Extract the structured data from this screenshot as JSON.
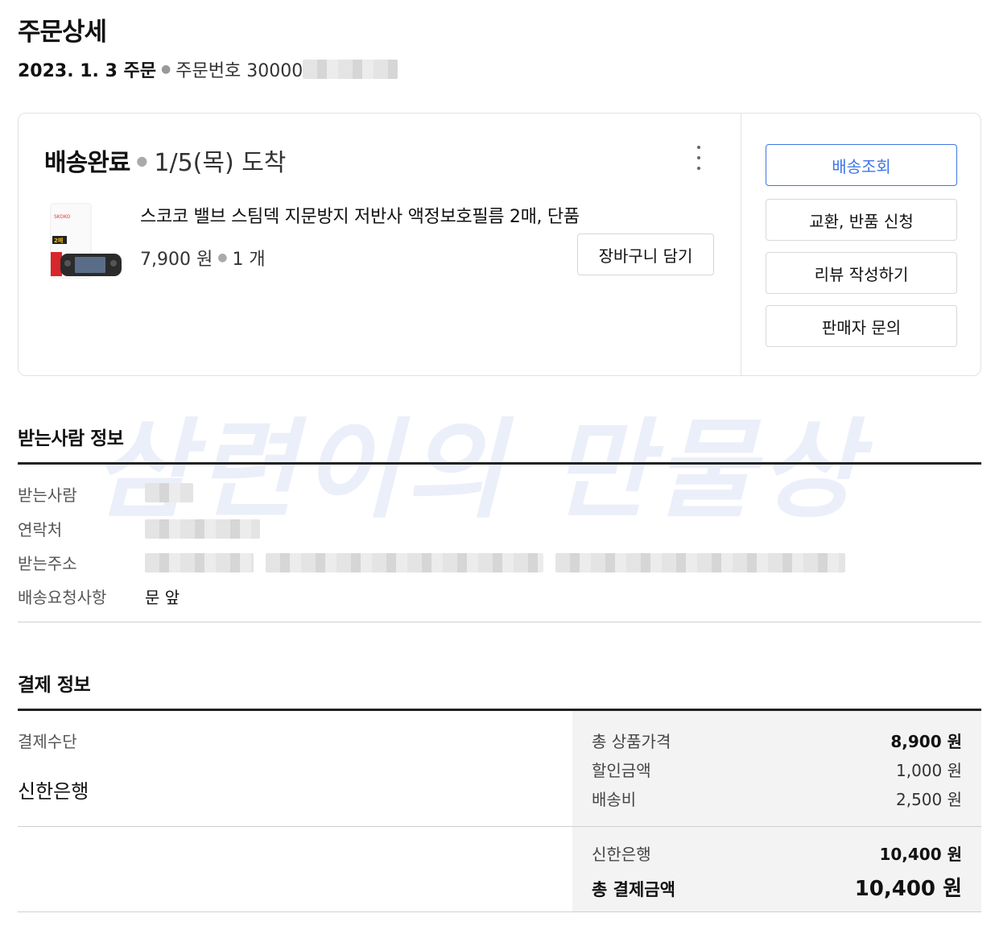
{
  "page": {
    "title": "주문상세"
  },
  "order": {
    "date_label": "2023. 1. 3 주문",
    "number_label": "주문번호 30000"
  },
  "shipment": {
    "status": "배송완료",
    "arrival": "1/5(목) 도착",
    "product": {
      "name": "스코코 밸브 스팀덱 지문방지 저반사 액정보호필름 2매, 단품",
      "price": "7,900 원",
      "quantity": "1 개",
      "thumb_brand": "SKOKO",
      "thumb_badge": "2매"
    },
    "cart_button": "장바구니 담기",
    "actions": [
      "배송조회",
      "교환, 반품 신청",
      "리뷰 작성하기",
      "판매자 문의"
    ]
  },
  "watermark": "삼련이의 만물상",
  "recipient": {
    "section_title": "받는사람 정보",
    "rows": [
      {
        "label": "받는사람",
        "value": ""
      },
      {
        "label": "연락처",
        "value": ""
      },
      {
        "label": "받는주소",
        "value": ""
      },
      {
        "label": "배송요청사항",
        "value": "문 앞"
      }
    ]
  },
  "payment": {
    "section_title": "결제 정보",
    "method_label": "결제수단",
    "method": "신한은행",
    "lines": [
      {
        "label": "총 상품가격",
        "amount": "8,900 원"
      },
      {
        "label": "할인금액",
        "amount": "1,000 원"
      },
      {
        "label": "배송비",
        "amount": "2,500 원"
      }
    ],
    "bank_line": {
      "label": "신한은행",
      "amount": "10,400 원"
    },
    "total": {
      "label": "총 결제금액",
      "amount": "10,400 원"
    }
  },
  "colors": {
    "accent": "#3f76e6",
    "panel_bg": "#f3f3f3",
    "watermark": "#466ec8"
  },
  "icons": {
    "more": "kebab-vertical-icon"
  }
}
